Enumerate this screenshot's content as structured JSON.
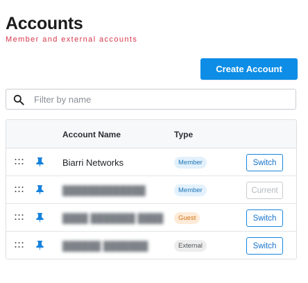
{
  "header": {
    "title": "Accounts",
    "subtitle": "Member and external accounts",
    "subtitle_color": "#d6364b"
  },
  "toolbar": {
    "create_label": "Create Account",
    "accent_color": "#0d8de6"
  },
  "filter": {
    "placeholder": "Filter by name",
    "value": "",
    "icon": "search-icon"
  },
  "table": {
    "columns": {
      "name": "Account Name",
      "type": "Type"
    },
    "rows": [
      {
        "name": "Biarri Networks",
        "type": "Member",
        "action": "Switch",
        "action_enabled": true,
        "pinned": true
      },
      {
        "name": "",
        "type": "Member",
        "action": "Current",
        "action_enabled": false,
        "pinned": true
      },
      {
        "name": "",
        "type": "Guest",
        "action": "Switch",
        "action_enabled": true,
        "pinned": true
      },
      {
        "name": "",
        "type": "External",
        "action": "Switch",
        "action_enabled": true,
        "pinned": true
      }
    ]
  },
  "icons": {
    "drag": "drag-handle-icon",
    "pin": "pin-icon"
  }
}
